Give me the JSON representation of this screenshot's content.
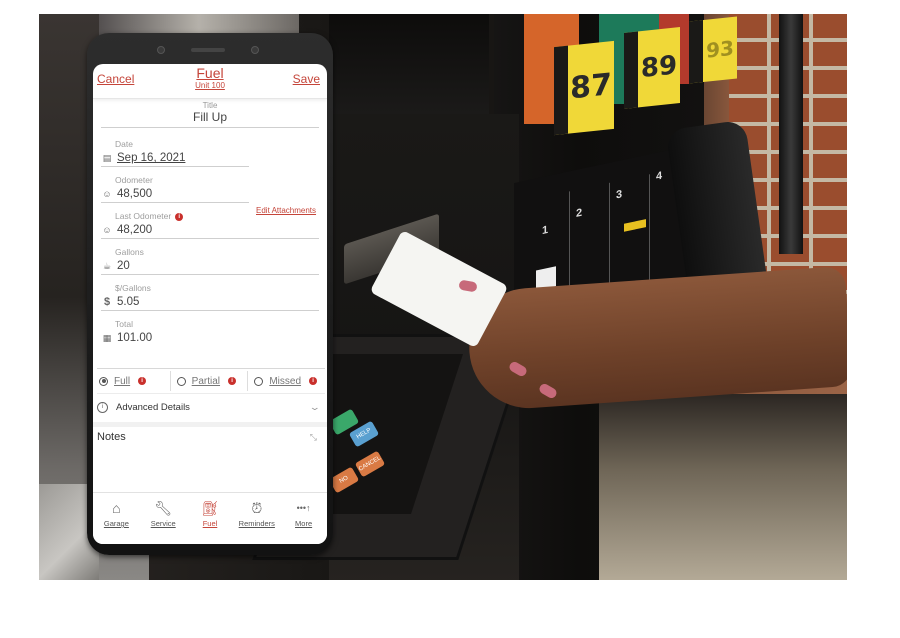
{
  "background_photo": {
    "subject": "hand inserting card into fuel pump card slot",
    "pump_grades": [
      "87",
      "89",
      "93"
    ],
    "instruction_steps": [
      "1",
      "2",
      "3",
      "4"
    ],
    "keypad_buttons": [
      "HELP",
      "CANCEL",
      "NO"
    ]
  },
  "app": {
    "navbar": {
      "cancel_label": "Cancel",
      "title": "Fuel",
      "subtitle": "Unit 100",
      "save_label": "Save"
    },
    "title_field": {
      "label": "Title",
      "value": "Fill Up"
    },
    "fields": {
      "date": {
        "label": "Date",
        "value": "Sep 16, 2021",
        "icon": "calendar-icon"
      },
      "odometer": {
        "label": "Odometer",
        "value": "48,500",
        "icon": "gauge-icon"
      },
      "last_odometer": {
        "label": "Last Odometer",
        "value": "48,200",
        "icon": "gauge-icon"
      },
      "gallons": {
        "label": "Gallons",
        "value": "20",
        "icon": "fuel-can-icon"
      },
      "price_per_gallon": {
        "label": "$/Gallons",
        "value": "5.05",
        "icon": "dollar-icon"
      },
      "total": {
        "label": "Total",
        "value": "101.00",
        "icon": "calculator-icon"
      }
    },
    "edit_attachments_label": "Edit Attachments",
    "fill_types": [
      {
        "label": "Full",
        "selected": true
      },
      {
        "label": "Partial",
        "selected": false
      },
      {
        "label": "Missed",
        "selected": false
      }
    ],
    "advanced_details_label": "Advanced Details",
    "notes_label": "Notes",
    "tabbar": [
      {
        "label": "Garage",
        "icon": "garage-icon",
        "active": false
      },
      {
        "label": "Service",
        "icon": "wrench-icon",
        "active": false
      },
      {
        "label": "Fuel",
        "icon": "fuel-pump-icon",
        "active": true
      },
      {
        "label": "Reminders",
        "icon": "alarm-clock-icon",
        "active": false
      },
      {
        "label": "More",
        "icon": "more-icon",
        "active": false
      }
    ],
    "accent_color": "#c5453a",
    "info_color": "#c9302c"
  }
}
